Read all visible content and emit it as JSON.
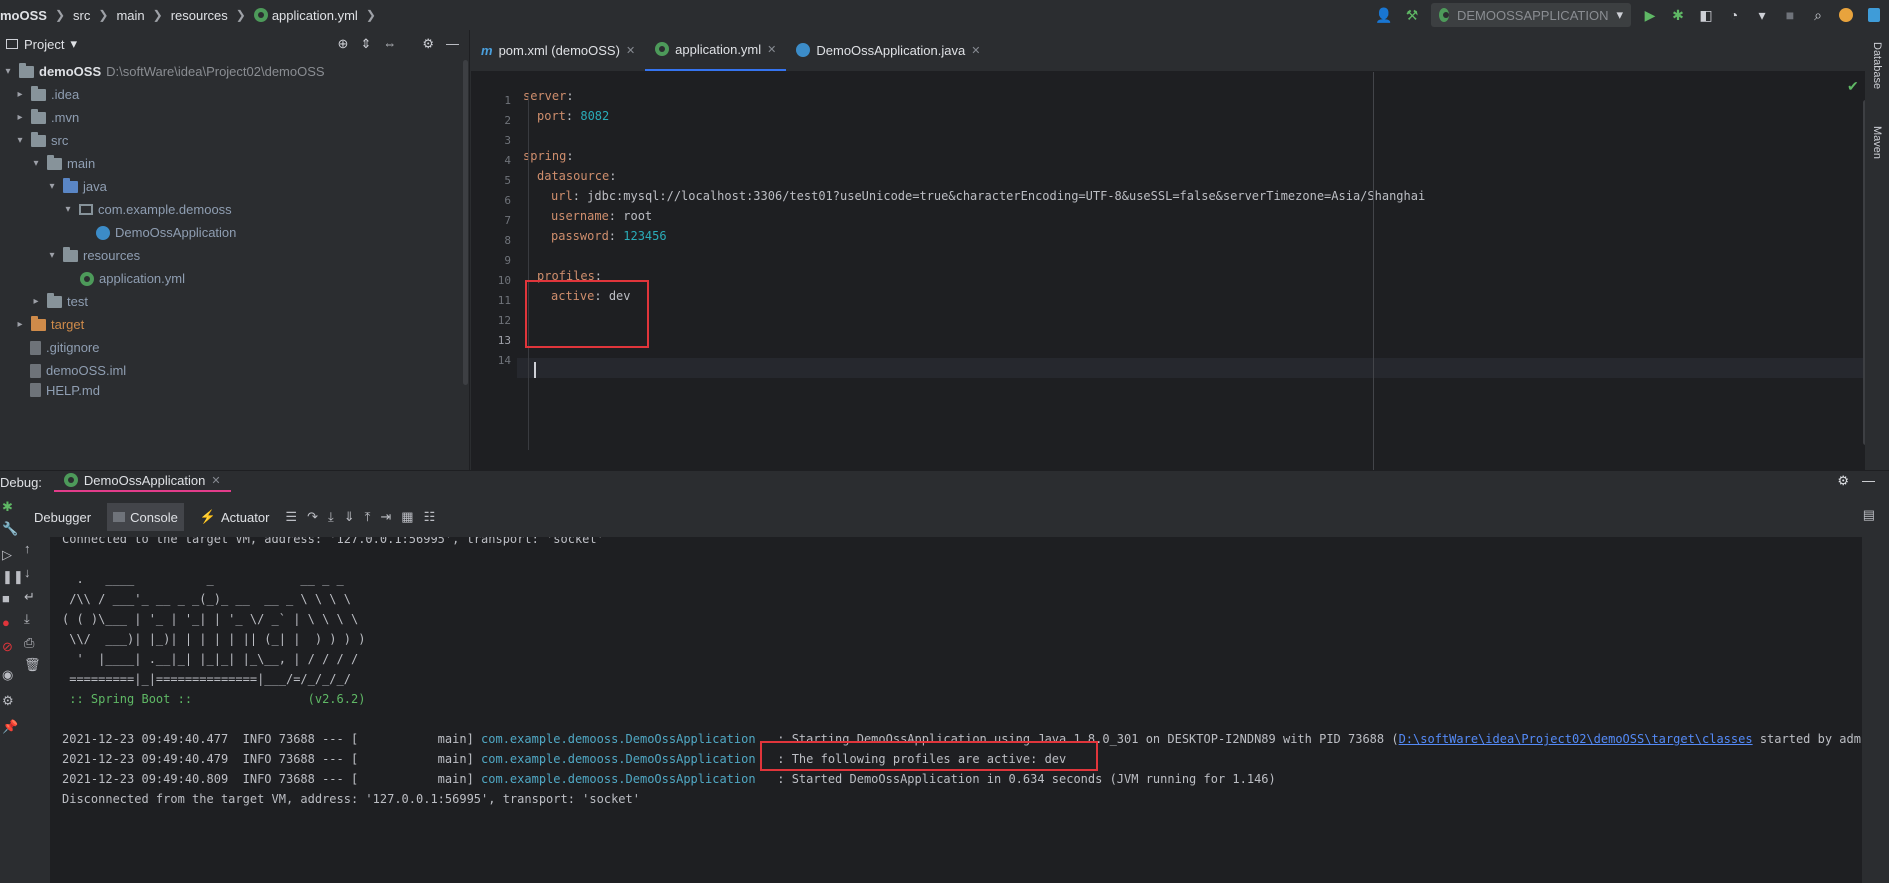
{
  "breadcrumb": {
    "items": [
      "moOSS",
      "src",
      "main",
      "resources",
      "application.yml"
    ]
  },
  "toolbar": {
    "run_config": "DEMOOSSAPPLICATION"
  },
  "project": {
    "title": "Project",
    "tree": [
      {
        "label": "demoOSS",
        "extra": "D:\\softWare\\idea\\Project02\\demoOSS"
      },
      {
        "label": ".idea"
      },
      {
        "label": ".mvn"
      },
      {
        "label": "src"
      },
      {
        "label": "main"
      },
      {
        "label": "java"
      },
      {
        "label": "com.example.demooss"
      },
      {
        "label": "DemoOssApplication"
      },
      {
        "label": "resources"
      },
      {
        "label": "application.yml"
      },
      {
        "label": "test"
      },
      {
        "label": "target"
      },
      {
        "label": ".gitignore"
      },
      {
        "label": "demoOSS.iml"
      },
      {
        "label": "HELP.md"
      }
    ]
  },
  "editor": {
    "tabs": [
      {
        "label": "pom.xml (demoOSS)"
      },
      {
        "label": "application.yml"
      },
      {
        "label": "DemoOssApplication.java"
      }
    ],
    "line_numbers": [
      "1",
      "2",
      "3",
      "4",
      "5",
      "6",
      "7",
      "8",
      "9",
      "10",
      "11",
      "12",
      "13",
      "14"
    ],
    "code": {
      "l1_key": "server",
      "l2_key": "port",
      "l2_val": "8082",
      "l4_key": "spring",
      "l5_key": "datasource",
      "l6_key": "url",
      "l6_val": "jdbc:mysql://localhost:3306/test01?useUnicode=true&characterEncoding=UTF-8&useSSL=false&serverTimezone=Asia/Shanghai",
      "l7_key": "username",
      "l7_val": "root",
      "l8_key": "password",
      "l8_val": "123456",
      "l10_key": "profiles",
      "l11_key": "active",
      "l11_val": "dev"
    }
  },
  "right_strip": {
    "database": "Database",
    "maven": "Maven"
  },
  "debug": {
    "label": "Debug:",
    "session": "DemoOssApplication",
    "subtabs": {
      "debugger": "Debugger",
      "console": "Console",
      "actuator": "Actuator"
    },
    "console_lines": [
      "Connected to the target VM, address: '127.0.0.1:56995', transport: 'socket'",
      "  .   ____          _            __ _ _",
      " /\\\\ / ___'_ __ _ _(_)_ __  __ _ \\ \\ \\ \\",
      "( ( )\\___ | '_ | '_| | '_ \\/ _` | \\ \\ \\ \\",
      " \\\\/  ___)| |_)| | | | | || (_| |  ) ) ) )",
      "  '  |____| .__|_| |_|_| |_\\__, | / / / /",
      " =========|_|==============|___/=/_/_/_/",
      " :: Spring Boot ::                (v2.6.2)"
    ],
    "logs": [
      {
        "prefix": "2021-12-23 09:49:40.477  INFO 73688 --- [           main] ",
        "logger": "com.example.demooss.DemoOssApplication",
        "message": "   : Starting DemoOssApplication using Java 1.8.0_301 on DESKTOP-I2NDN89 with PID 73688 (",
        "link": "D:\\softWare\\idea\\Project02\\demoOSS\\target\\classes",
        "tail": " started by admin in D:"
      },
      {
        "prefix": "2021-12-23 09:49:40.479  INFO 73688 --- [           main] ",
        "logger": "com.example.demooss.DemoOssApplication",
        "message": "   : The following profiles are active: dev"
      },
      {
        "prefix": "2021-12-23 09:49:40.809  INFO 73688 --- [           main] ",
        "logger": "com.example.demooss.DemoOssApplication",
        "message": "   : Started DemoOssApplication in 0.634 seconds (JVM running for 1.146)"
      }
    ],
    "disconnected": "Disconnected from the target VM, address: '127.0.0.1:56995', transport: 'socket'"
  }
}
